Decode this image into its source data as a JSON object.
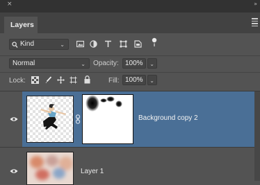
{
  "panel": {
    "close_symbol": "×",
    "collapse_symbol": "»",
    "tab_label": "Layers",
    "menu_icon": "panel-menu-icon"
  },
  "filter": {
    "kind_label": "Kind",
    "icons": [
      "pixel-filter-icon",
      "adjustment-filter-icon",
      "type-filter-icon",
      "shape-filter-icon",
      "smart-object-filter-icon",
      "filter-toggle-icon"
    ]
  },
  "blend": {
    "mode": "Normal",
    "opacity_label": "Opacity:",
    "opacity_value": "100%"
  },
  "lock": {
    "label": "Lock:",
    "fill_label": "Fill:",
    "fill_value": "100%"
  },
  "layers": [
    {
      "name": "Background copy 2",
      "selected": true,
      "visible": true,
      "has_mask": true
    },
    {
      "name": "Layer 1",
      "selected": false,
      "visible": true,
      "has_mask": false
    }
  ],
  "colors": {
    "panel_bg": "#535353",
    "selected_row": "#4a6f96",
    "header_bg": "#323232"
  }
}
